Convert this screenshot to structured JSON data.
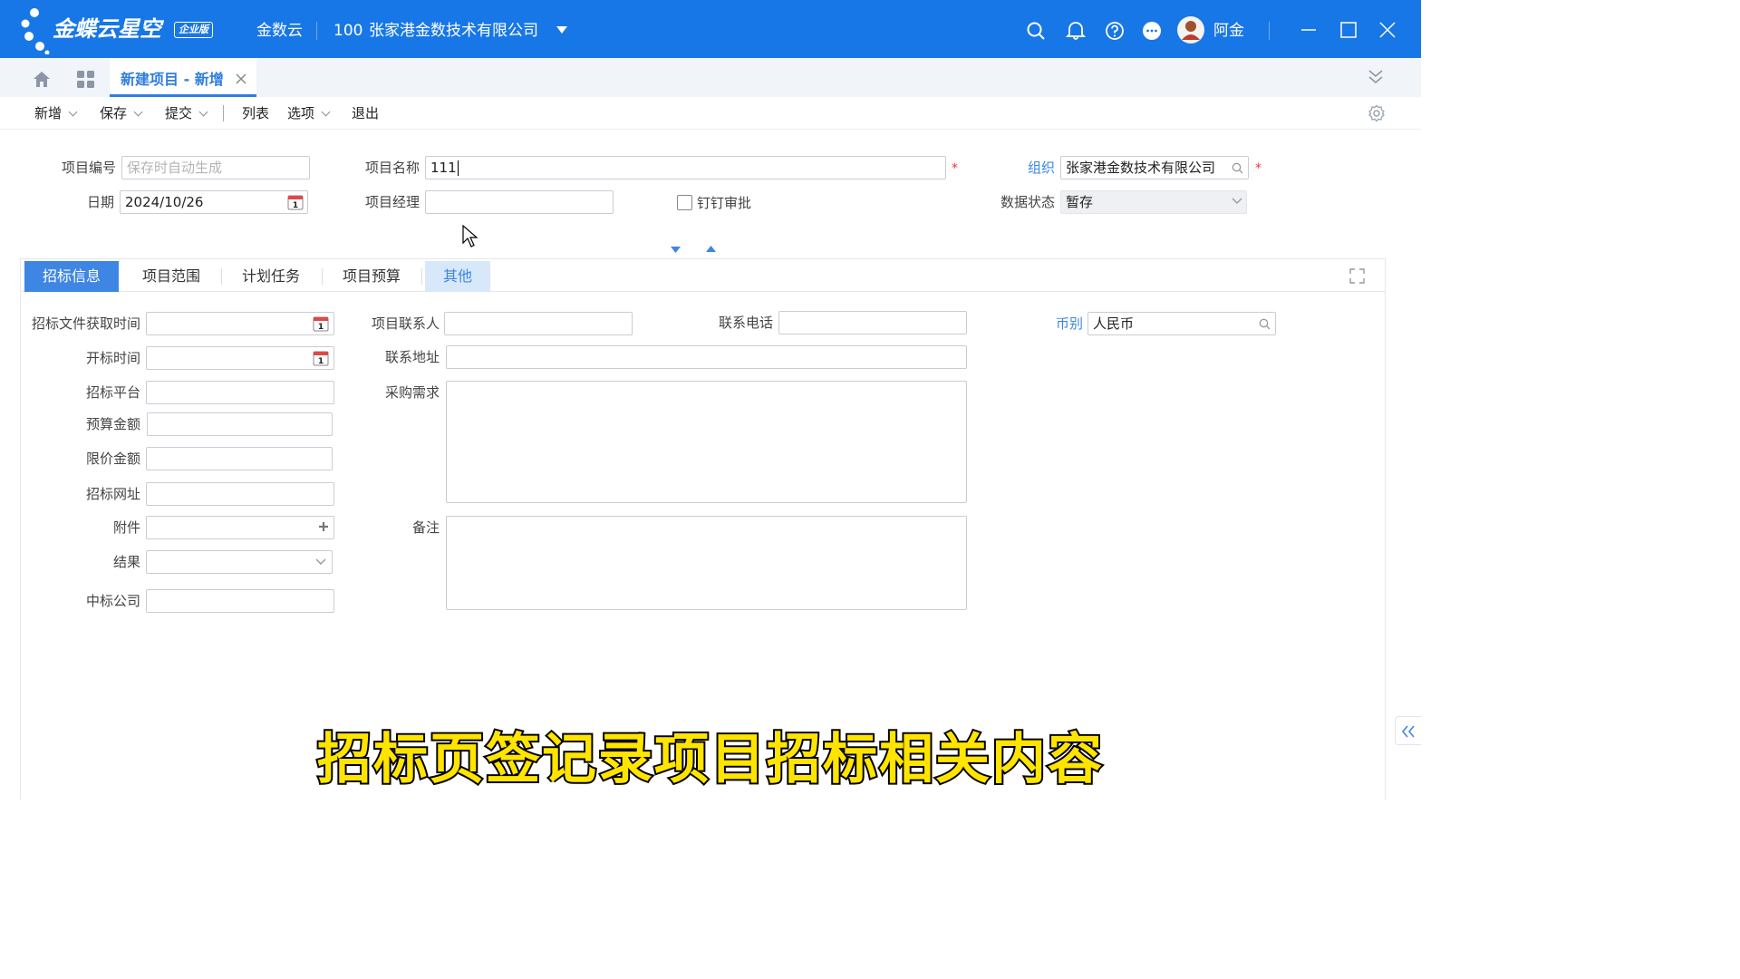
{
  "app": {
    "logo_text": "金蝶云星空",
    "edition_badge": "企业版",
    "product": "金数云",
    "org_code": "100",
    "org_name": "张家港金数技术有限公司",
    "user_name": "阿金"
  },
  "tabs": {
    "active_tab": "新建项目 - 新增"
  },
  "toolbar": {
    "new_label": "新增",
    "save_label": "保存",
    "submit_label": "提交",
    "list_label": "列表",
    "options_label": "选项",
    "exit_label": "退出"
  },
  "header_form": {
    "project_no_label": "项目编号",
    "project_no_placeholder": "保存时自动生成",
    "project_name_label": "项目名称",
    "project_name_value": "111",
    "org_label": "组织",
    "org_value": "张家港金数技术有限公司",
    "date_label": "日期",
    "date_value": "2024/10/26",
    "manager_label": "项目经理",
    "manager_value": "",
    "dingtalk_label": "钉钉审批",
    "dingtalk_checked": false,
    "status_label": "数据状态",
    "status_value": "暂存"
  },
  "body_tabs": [
    "招标信息",
    "项目范围",
    "计划任务",
    "项目预算",
    "其他"
  ],
  "tender_form": {
    "doc_time_label": "招标文件获取时间",
    "open_time_label": "开标时间",
    "platform_label": "招标平台",
    "budget_label": "预算金额",
    "limit_label": "限价金额",
    "url_label": "招标网址",
    "attachment_label": "附件",
    "result_label": "结果",
    "winner_label": "中标公司",
    "contact_label": "项目联系人",
    "address_label": "联系地址",
    "demand_label": "采购需求",
    "remark_label": "备注",
    "phone_label": "联系电话",
    "currency_label": "币别",
    "currency_value": "人民币"
  },
  "caption": "招标页签记录项目招标相关内容",
  "colors": {
    "topbar": "#1877e6",
    "accent": "#3f86e4",
    "required": "#e03a3a",
    "caption": "#ffe400"
  }
}
